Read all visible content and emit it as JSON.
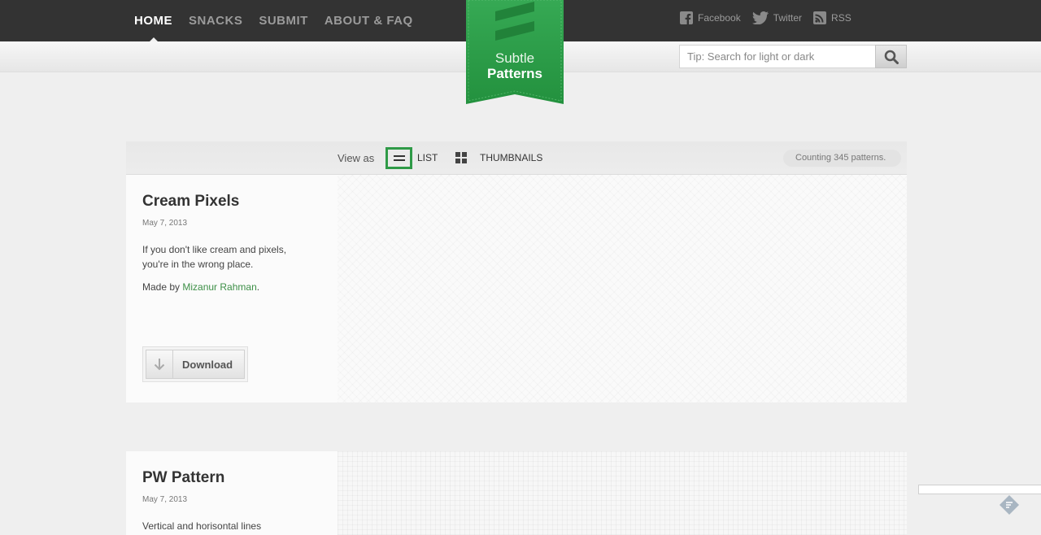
{
  "nav": {
    "items": [
      {
        "label": "HOME",
        "active": true
      },
      {
        "label": "SNACKS",
        "active": false
      },
      {
        "label": "SUBMIT",
        "active": false
      },
      {
        "label": "ABOUT & FAQ",
        "active": false
      }
    ]
  },
  "social": {
    "facebook": "Facebook",
    "twitter": "Twitter",
    "rss": "RSS"
  },
  "logo": {
    "line1": "Subtle",
    "line2": "Patterns"
  },
  "search": {
    "placeholder": "Tip: Search for light or dark"
  },
  "viewbar": {
    "view_as": "View as",
    "list_label": "LIST",
    "thumbnails_label": "THUMBNAILS",
    "counter": "Counting 345 patterns."
  },
  "patterns": [
    {
      "title": "Cream Pixels",
      "date": "May 7, 2013",
      "description": "If you don't like cream and pixels, you're in the wrong place.",
      "made_by_prefix": "Made by",
      "author": "Mizanur Rahman",
      "made_by_suffix": ".",
      "download_label": "Download"
    },
    {
      "title": "PW Pattern",
      "date": "May 7, 2013",
      "description": "Vertical and horisontal lines"
    }
  ],
  "colors": {
    "topbar": "#333333",
    "accent_green": "#2f9a47",
    "link_green": "#3d8f47",
    "background": "#efefef"
  }
}
